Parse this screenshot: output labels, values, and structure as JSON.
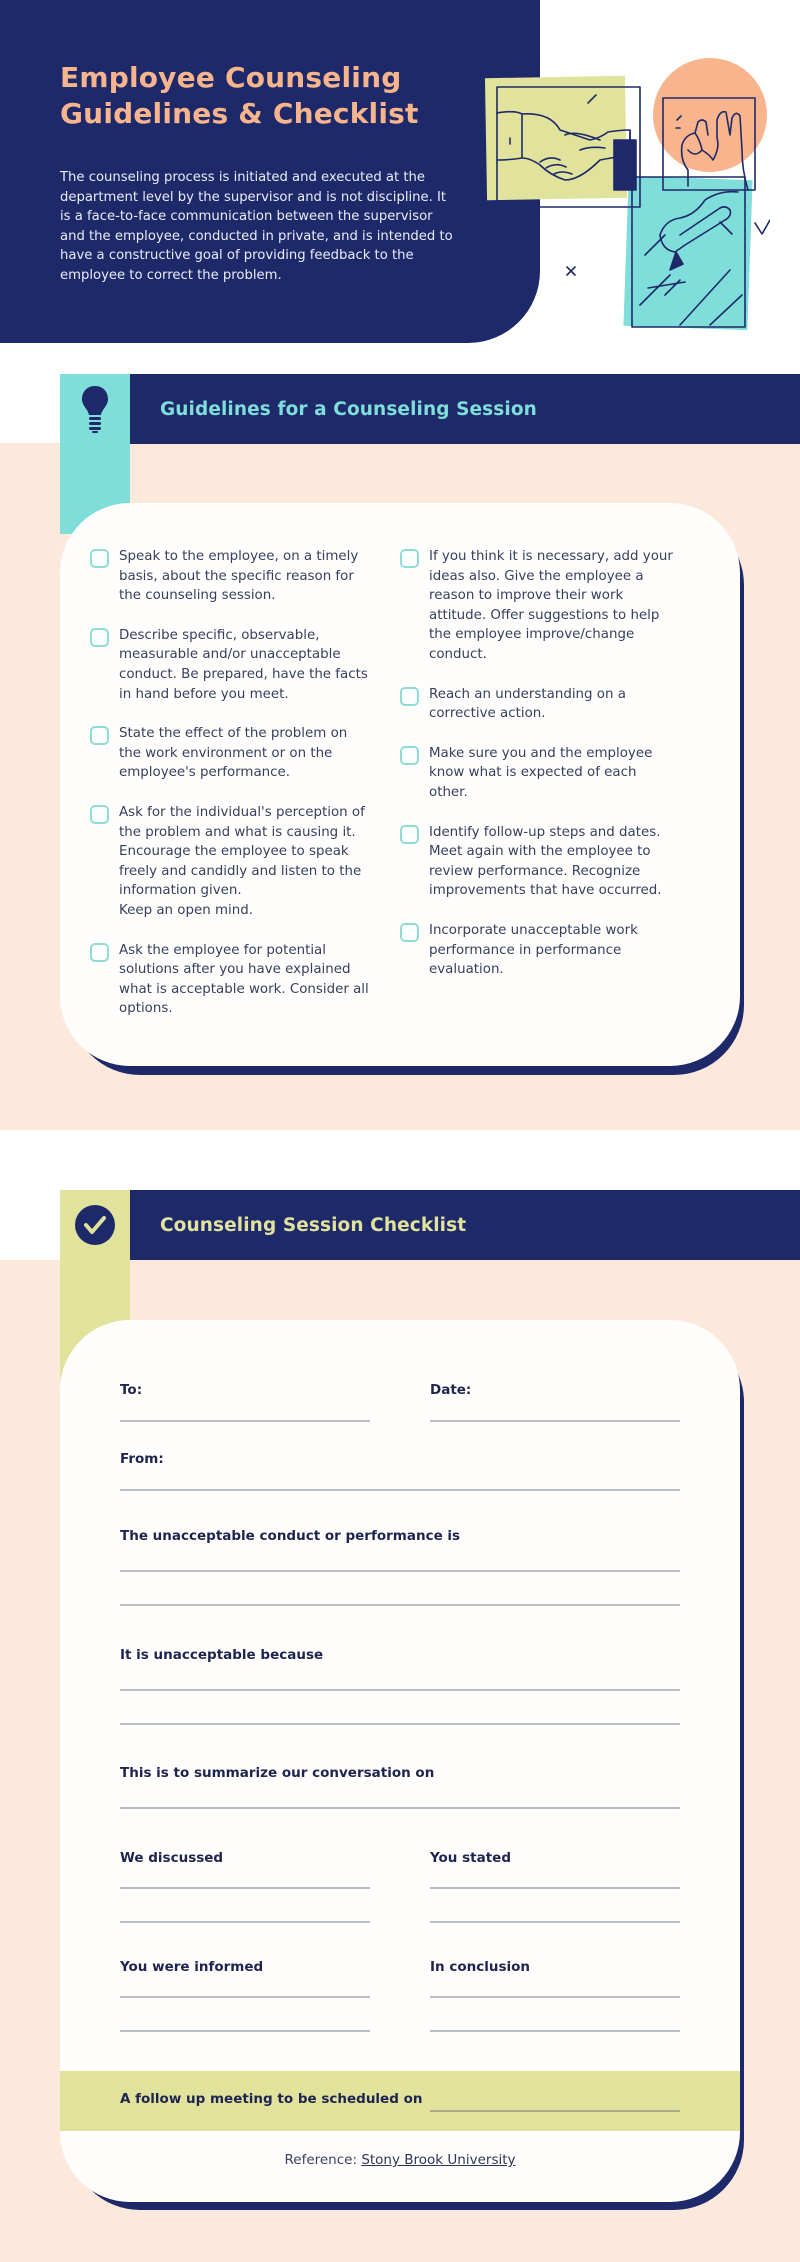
{
  "hero": {
    "title_line1": "Employee Counseling",
    "title_line2": "Guidelines & Checklist",
    "description": "The counseling process is initiated and executed at the department level by the supervisor and is not discipline. It is a face-to-face communication between the supervisor and the employee, conducted in private, and is intended to have a constructive goal of providing feedback to the employee to correct the problem.",
    "illustration_icons": [
      "handshake-icon",
      "ok-hand-icon",
      "hand-writing-icon"
    ]
  },
  "colors": {
    "navy": "#1e296a",
    "peach": "#f8b58d",
    "teal": "#7fded9",
    "lime": "#e1e39d",
    "cream": "#fde9dc"
  },
  "guidelines": {
    "icon": "lightbulb-icon",
    "title": "Guidelines for a Counseling Session",
    "left_items": [
      "Speak to the employee, on a timely basis, about the specific reason for the counseling session.",
      "Describe specific, observable, measurable and/or unacceptable conduct. Be prepared, have the facts in hand before you meet.",
      "State the effect of the problem on the work environment or on the employee's performance.",
      "Ask for the individual's perception of the problem and what is causing it. Encourage the employee to speak freely and candidly and listen to the information given.\nKeep an open mind.",
      "Ask the employee for potential solutions after you have explained what is acceptable work. Consider all options."
    ],
    "right_items": [
      "If you think it is necessary, add your ideas also. Give the employee a reason to improve their work attitude. Offer suggestions to help the employee improve/change conduct.",
      "Reach an understanding on a corrective action.",
      "Make sure you and the employee know what is expected of each other.",
      "Identify follow-up steps and dates. Meet again with the employee to review performance. Recognize improvements that have occurred.",
      "Incorporate unacceptable work performance in performance evaluation."
    ]
  },
  "checklist": {
    "icon": "checkmark-circle-icon",
    "title": "Counseling Session Checklist",
    "fields": {
      "to": "To:",
      "date": "Date:",
      "from": "From:",
      "conduct": "The unacceptable conduct or performance is",
      "because": "It is unacceptable because",
      "summarize": "This is to summarize our conversation on",
      "discussed": "We discussed",
      "stated": "You stated",
      "informed": "You were informed",
      "conclusion": "In conclusion",
      "followup": "A follow up meeting to be scheduled on"
    },
    "reference_label": "Reference:",
    "reference_link": "Stony Brook University"
  }
}
